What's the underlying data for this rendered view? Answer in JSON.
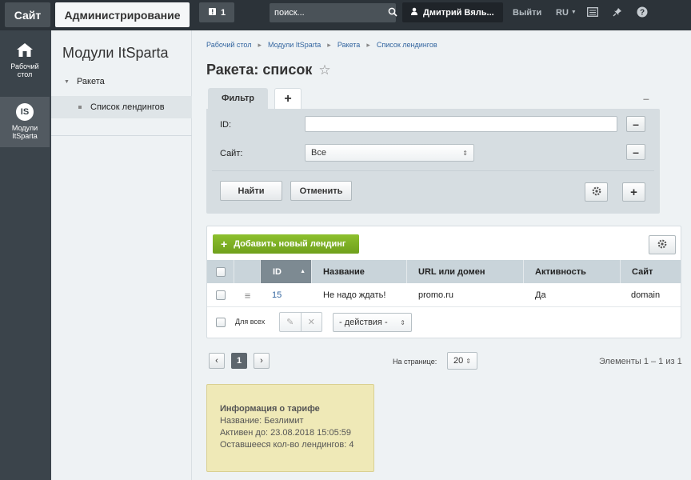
{
  "topbar": {
    "site_label": "Сайт",
    "admin_label": "Администрирование",
    "notifications_count": "1",
    "search_placeholder": "поиск...",
    "user_name": "Дмитрий Вяль...",
    "logout_label": "Выйти",
    "lang_label": "RU"
  },
  "leftnav": [
    {
      "label_line1": "Рабочий",
      "label_line2": "стол"
    },
    {
      "badge": "IS",
      "label_line1": "Модули",
      "label_line2": "ItSparta"
    }
  ],
  "sidebar": {
    "title": "Модули ItSparta",
    "items": [
      {
        "label": "Ракета"
      },
      {
        "label": "Список лендингов"
      }
    ]
  },
  "breadcrumbs": [
    "Рабочий стол",
    "Модули ItSparta",
    "Ракета",
    "Список лендингов"
  ],
  "page_title": "Ракета: список",
  "filter": {
    "tab_label": "Фильтр",
    "add_tab_label": "+",
    "collapse_label": "–",
    "id_label": "ID:",
    "id_value": "",
    "site_label": "Сайт:",
    "site_value": "Все",
    "find_button": "Найти",
    "cancel_button": "Отменить"
  },
  "table": {
    "add_button": "Добавить новый лендинг",
    "columns": [
      "ID",
      "Название",
      "URL или домен",
      "Активность",
      "Сайт"
    ],
    "rows": [
      {
        "id": "15",
        "name": "Не надо ждать!",
        "url": "promo.ru",
        "active": "Да",
        "site": "domain"
      }
    ],
    "for_all_label": "Для всех",
    "actions_value": "- действия -"
  },
  "pagination": {
    "current_page": "1",
    "per_page_label": "На странице:",
    "per_page_value": "20",
    "elements_label": "Элементы 1 – 1 из 1"
  },
  "tariff": {
    "title": "Информация о тарифе",
    "line1": "Название: Безлимит",
    "line2": "Активен до: 23.08.2018 15:05:59",
    "line3": "Оставшееся кол-во лендингов: 4"
  },
  "colors": {
    "topbar": "#2c3339",
    "leftnav": "#3b444b",
    "accent_green": "#7ab024",
    "link_blue": "#3466a0",
    "tariff_bg": "#efe9b7"
  }
}
